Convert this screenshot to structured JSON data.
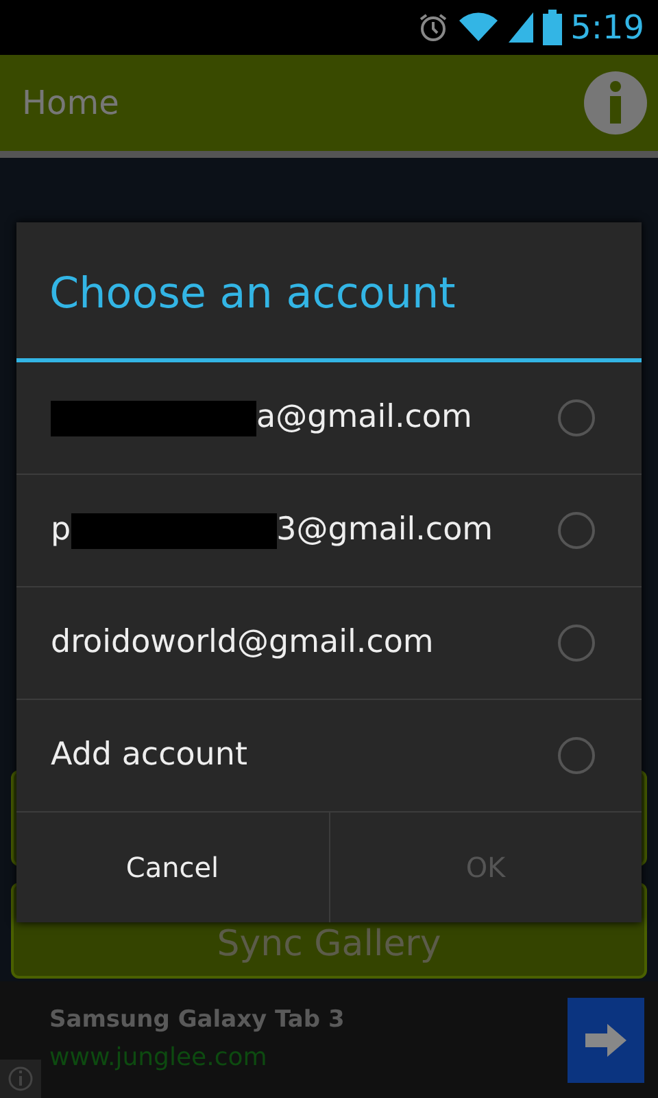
{
  "status_bar": {
    "time": "5:19"
  },
  "app_bar": {
    "title": "Home"
  },
  "background_buttons": [
    {
      "kind": "blank"
    },
    {
      "kind": "labeled",
      "label": "Sync Gallery"
    }
  ],
  "dialog": {
    "title": "Choose an account",
    "accounts": [
      {
        "kind": "redacted",
        "visible_end": "a@gmail.com",
        "selected": false
      },
      {
        "kind": "redacted",
        "visible_start": "p",
        "visible_end": "3@gmail.com",
        "selected": false
      },
      {
        "kind": "plain",
        "visible_end": "droidoworld@gmail.com",
        "selected": false
      },
      {
        "kind": "plain",
        "visible_end": "Add account",
        "selected": false
      }
    ],
    "buttons": [
      {
        "label": "Cancel",
        "disabled": false
      },
      {
        "label": "OK",
        "disabled": true
      }
    ]
  },
  "ad": {
    "headline": "Samsung Galaxy Tab 3",
    "url": "www.junglee.com"
  }
}
